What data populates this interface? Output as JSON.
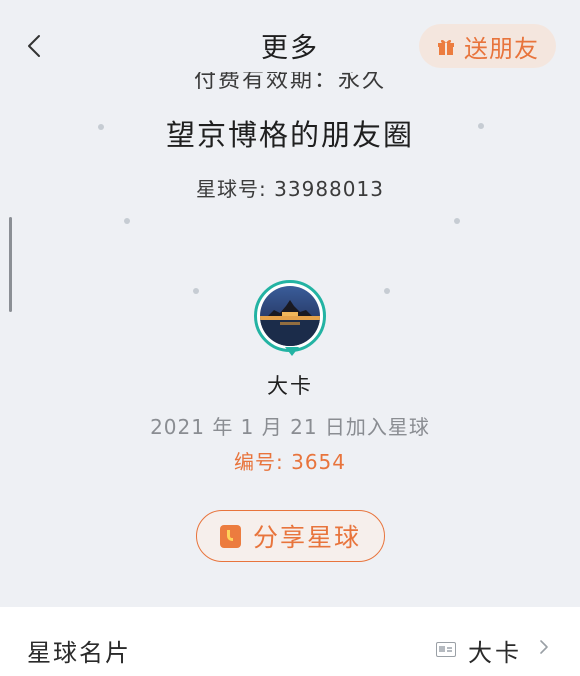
{
  "header": {
    "title": "更多",
    "back_icon": "chevron-left-icon",
    "gift_button": {
      "label": "送朋友",
      "icon": "gift-icon"
    }
  },
  "planet": {
    "clipped_line": "付费有效期：永久",
    "name": "望京博格的朋友圈",
    "id_text": "星球号: 33988013"
  },
  "member": {
    "avatar_icon": "avatar",
    "name": "大卡",
    "join_date": "2021 年 1 月 21 日加入星球",
    "number_text": "编号: 3654"
  },
  "share_button": {
    "label": "分享星球",
    "icon": "share-icon"
  },
  "card_row": {
    "label": "星球名片",
    "value": "大卡",
    "icon": "id-card-icon",
    "chevron": "chevron-right-icon"
  },
  "colors": {
    "accent": "#e8743c",
    "avatar_ring": "#23b3a3",
    "background": "#eef0f4"
  }
}
